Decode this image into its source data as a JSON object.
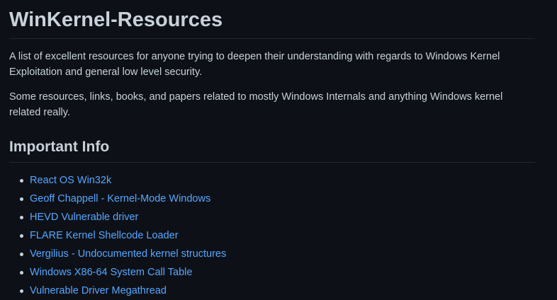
{
  "readme": {
    "title": "WinKernel-Resources",
    "intro_1": "A list of excellent resources for anyone trying to deepen their understanding with regards to Windows Kernel Exploitation and general low level security.",
    "intro_2": "Some resources, links, books, and papers related to mostly Windows Internals and anything Windows kernel related really.",
    "section_heading": "Important Info",
    "links": [
      {
        "label": "React OS Win32k"
      },
      {
        "label": "Geoff Chappell - Kernel-Mode Windows"
      },
      {
        "label": "HEVD Vulnerable driver"
      },
      {
        "label": "FLARE Kernel Shellcode Loader"
      },
      {
        "label": "Vergilius - Undocumented kernel structures"
      },
      {
        "label": "Windows X86-64 System Call Table"
      },
      {
        "label": "Vulnerable Driver Megathread"
      }
    ]
  },
  "colors": {
    "background": "#0d1117",
    "text": "#c9d1d9",
    "link": "#58a6ff",
    "divider": "#21262d"
  }
}
